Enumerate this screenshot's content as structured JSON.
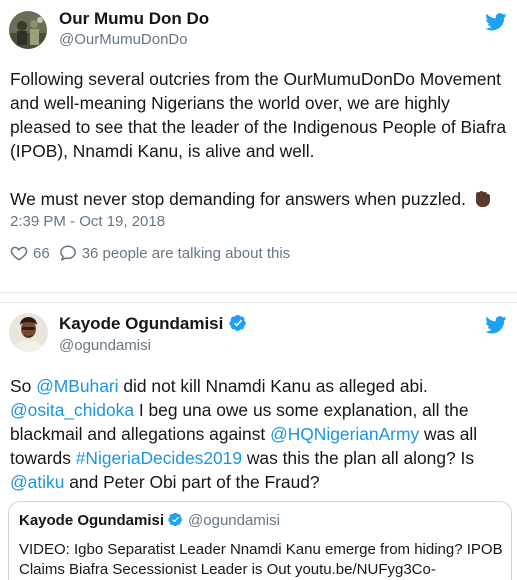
{
  "tweets": [
    {
      "display_name": "Our Mumu Don Do",
      "handle": "@OurMumuDonDo",
      "avatar_icon": "avatar-photo-icon",
      "text_p1": "Following several outcries from the OurMumuDonDo Movement and well-meaning Nigerians the world over, we are highly pleased to see that the leader of the Indigenous People of Biafra (IPOB), Nnamdi Kanu, is alive and well.",
      "text_p2": "We must never stop demanding for answers when puzzled.",
      "emoji": "raised-fist-icon",
      "timestamp": "2:39 PM - Oct 19, 2018",
      "like_count": "66",
      "talking_text": "36 people are talking about this"
    },
    {
      "display_name": "Kayode Ogundamisi",
      "handle": "@ogundamisi",
      "verified": true,
      "text_segments": [
        {
          "t": "So ",
          "link": false
        },
        {
          "t": "@MBuhari",
          "link": true
        },
        {
          "t": " did not kill Nnamdi Kanu as alleged abi. ",
          "link": false
        },
        {
          "t": "@osita_chidoka",
          "link": true
        },
        {
          "t": " I beg una owe us some explanation, all the blackmail and allegations against ",
          "link": false
        },
        {
          "t": "@HQNigerianArmy",
          "link": true
        },
        {
          "t": " was all towards ",
          "link": false
        },
        {
          "t": "#NigeriaDecides2019",
          "link": true
        },
        {
          "t": " was this the plan all along? Is ",
          "link": false
        },
        {
          "t": "@atiku",
          "link": true
        },
        {
          "t": " and Peter Obi part of the Fraud?",
          "link": false
        }
      ],
      "quote": {
        "display_name": "Kayode Ogundamisi",
        "handle": "@ogundamisi",
        "text": "VIDEO: Igbo Separatist Leader Nnamdi Kanu emerge from hiding? IPOB Claims Biafra Secessionist Leader is Out  youtu.be/NUFyg3Co-"
      }
    }
  ],
  "colors": {
    "text": "#14171a",
    "secondary": "#657786",
    "link": "#1b95e0",
    "twitter_blue": "#1da1f2",
    "border": "#e1e8ed"
  }
}
